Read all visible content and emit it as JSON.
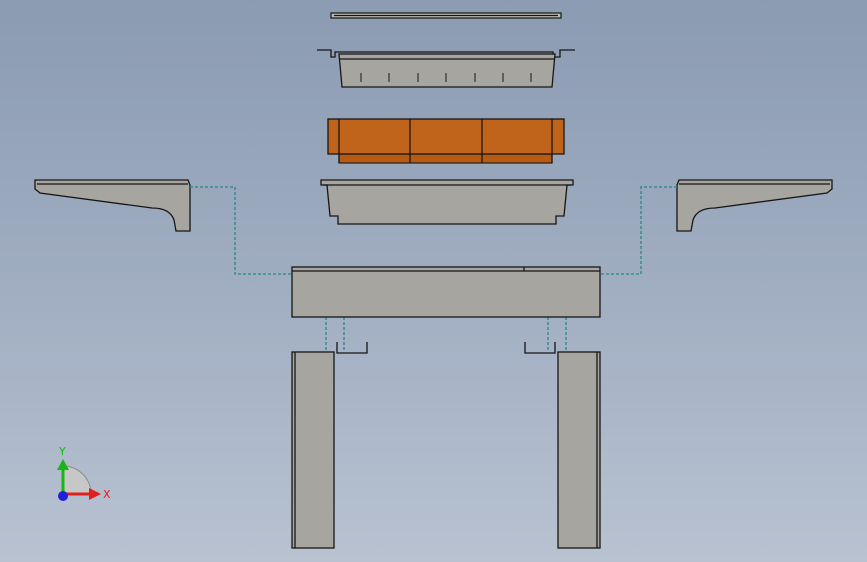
{
  "view": {
    "type": "exploded-assembly",
    "background_top": "#8b9bb2",
    "background_bottom": "#b8c2d1",
    "part_color": "#a7a59f",
    "brick_color": "#c0641b",
    "explode_line_color": "#1f8a87"
  },
  "parts": [
    "lid-plate",
    "tray",
    "brick-block",
    "basin",
    "left-bracket",
    "right-bracket",
    "beam",
    "left-clip",
    "right-clip",
    "left-leg",
    "right-leg"
  ],
  "triad": {
    "x_label": "X",
    "y_label": "Y",
    "x_color": "#e0201c",
    "y_color": "#18b418",
    "z_color": "#2020d8"
  }
}
